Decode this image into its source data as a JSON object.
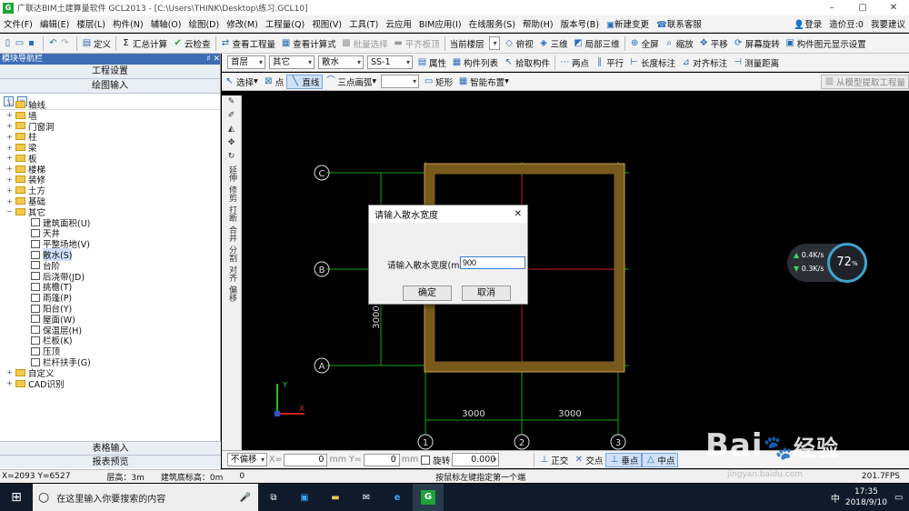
{
  "window": {
    "title": "广联达BIM土建算量软件 GCL2013 - [C:\\Users\\THINK\\Desktop\\练习.GCL10]",
    "minimize": "–",
    "maximize": "▢",
    "close": "✕"
  },
  "menu": {
    "items": [
      "文件(F)",
      "编辑(E)",
      "楼层(L)",
      "构件(N)",
      "辅轴(O)",
      "绘图(D)",
      "修改(M)",
      "工程量(Q)",
      "视图(V)",
      "工具(T)",
      "云应用",
      "BIM应用(I)",
      "在线服务(S)",
      "帮助(H)",
      "版本号(B)"
    ],
    "new_change": "新建变更",
    "contact": "联系客服",
    "login": "登录",
    "cost_beans": "造价豆:0",
    "suggest": "我要建议"
  },
  "toolbar1": {
    "define": "定义",
    "sum": "汇总计算",
    "cloud_check": "云检查",
    "view_qty": "查看工程量",
    "view_formula": "查看计算式",
    "batch_select": "批量选择",
    "flush": "平齐板顶",
    "current_floor": "当前楼层",
    "top_view": "俯视",
    "three_d": "三维",
    "local_3d": "局部三维",
    "full_screen": "全屏",
    "zoom": "缩放",
    "pan": "平移",
    "rotate": "屏幕旋转",
    "display_settings": "构件图元显示设置"
  },
  "toolbar2": {
    "floor": "首层",
    "category": "其它",
    "type": "散水",
    "name": "SS-1",
    "property": "属性",
    "component_list": "构件列表",
    "pick": "拾取构件",
    "two_point": "两点",
    "parallel": "平行",
    "len_mark": "长度标注",
    "align_mark": "对齐标注",
    "measure": "测量距离"
  },
  "toolbar3": {
    "select": "选择",
    "point": "点",
    "line": "直线",
    "arc": "三点画弧",
    "rect": "矩形",
    "smart": "智能布置",
    "extract": "从模型提取工程量"
  },
  "nav": {
    "header": "模块导航栏",
    "pin": "♯ ✕",
    "project_settings": "工程设置",
    "drawing_input": "绘图输入",
    "table_input": "表格输入",
    "report": "报表预览",
    "tree": [
      {
        "label": "轴线",
        "toggle": "+"
      },
      {
        "label": "墙",
        "toggle": "+"
      },
      {
        "label": "门窗洞",
        "toggle": "+"
      },
      {
        "label": "柱",
        "toggle": "+"
      },
      {
        "label": "梁",
        "toggle": "+"
      },
      {
        "label": "板",
        "toggle": "+"
      },
      {
        "label": "楼梯",
        "toggle": "+"
      },
      {
        "label": "装修",
        "toggle": "+"
      },
      {
        "label": "土方",
        "toggle": "+"
      },
      {
        "label": "基础",
        "toggle": "+"
      },
      {
        "label": "其它",
        "toggle": "−"
      }
    ],
    "children": [
      "建筑面积(U)",
      "天井",
      "平整场地(V)",
      "散水(S)",
      "台阶",
      "后浇带(JD)",
      "挑檐(T)",
      "雨篷(P)",
      "阳台(Y)",
      "屋面(W)",
      "保温层(H)",
      "栏板(K)",
      "压顶",
      "栏杆扶手(G)"
    ],
    "tree_tail": [
      {
        "label": "自定义",
        "toggle": "+"
      },
      {
        "label": "CAD识别",
        "toggle": "+"
      }
    ]
  },
  "lefttools": [
    "延伸",
    "修剪",
    "打断",
    "合并",
    "分割",
    "对齐",
    "偏移"
  ],
  "canvas": {
    "axes_rows": [
      "C",
      "B",
      "A"
    ],
    "axes_cols": [
      "1",
      "2",
      "3"
    ],
    "dims_v": [
      "3000",
      "3000"
    ],
    "dims_h": [
      "3000",
      "3000"
    ],
    "y_label": "Y",
    "x_label": "X"
  },
  "dialog": {
    "title": "请输入散水宽度",
    "label": "请输入散水宽度(mm)",
    "value": "900",
    "ok": "确定",
    "cancel": "取消",
    "close": "✕"
  },
  "speed": {
    "up": "0.4K/s",
    "down": "0.3K/s",
    "percent": "72",
    "unit": "%"
  },
  "bottombar": {
    "offset_mode": "不偏移",
    "x_label": "X=",
    "x_val": "0",
    "y_label": "mm Y=",
    "y_val": "0",
    "mm": "mm",
    "rotate": "旋转",
    "rot_val": "0.000",
    "ortho": "正交",
    "intersect": "交点",
    "perp": "垂点",
    "mid": "中点"
  },
  "status": {
    "coords": "X=2093 Y=6527",
    "floor_h": "层高：3m",
    "base_h": "建筑底标高：0m",
    "zero": "0",
    "hint": "按鼠标左键指定第一个端",
    "fps": "201.7FPS"
  },
  "taskbar": {
    "search_placeholder": "在这里输入你要搜索的内容",
    "time": "17:35",
    "date": "2018/9/10",
    "ime": "中"
  },
  "watermark": {
    "brand": "Bai",
    "brand2": "经验",
    "url": "jingyan.baidu.com"
  }
}
